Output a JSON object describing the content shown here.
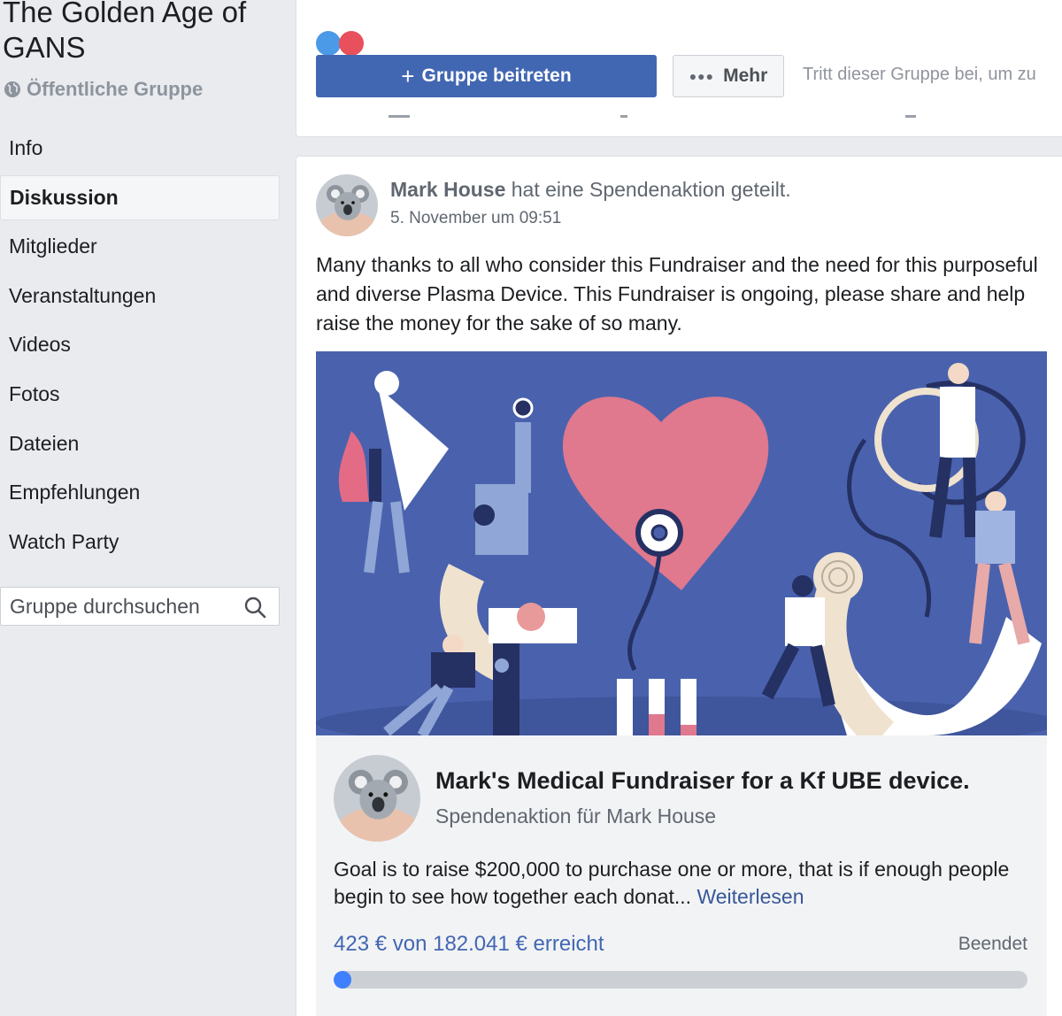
{
  "sidebar": {
    "group_name": "The Golden Age of GANS",
    "privacy": "Öffentliche Gruppe",
    "nav": [
      {
        "label": "Info"
      },
      {
        "label": "Diskussion",
        "active": true
      },
      {
        "label": "Mitglieder"
      },
      {
        "label": "Veranstaltungen"
      },
      {
        "label": "Videos"
      },
      {
        "label": "Fotos"
      },
      {
        "label": "Dateien"
      },
      {
        "label": "Empfehlungen"
      },
      {
        "label": "Watch Party"
      }
    ],
    "search_placeholder": "Gruppe durchsuchen"
  },
  "cover": {
    "join_label": "Gruppe beitreten",
    "more_label": "Mehr",
    "hint": "Tritt dieser Gruppe bei, um zu"
  },
  "post": {
    "author": "Mark House",
    "action": "hat eine Spendenaktion geteilt.",
    "timestamp": "5. November um 09:51",
    "text": "Many thanks to all who consider this Fundraiser and the need for this purposeful and diverse Plasma Device. This Fundraiser is ongoing, please share and help raise the money for the sake of so many.",
    "fundraiser": {
      "title": "Mark's Medical Fundraiser for a Kf UBE device.",
      "subtitle": "Spendenaktion für Mark House",
      "description": "Goal is to raise $200,000 to purchase one or more, that is if enough people begin to see how together each donat...",
      "read_more": "Weiterlesen",
      "progress_text": "423 € von 182.041 € erreicht",
      "status": "Beendet",
      "progress_fraction": 0.0023
    }
  },
  "colors": {
    "facebook_blue": "#4267b2",
    "link_blue": "#385898",
    "progress_blue": "#4080ff",
    "page_bg": "#e9ebee"
  }
}
